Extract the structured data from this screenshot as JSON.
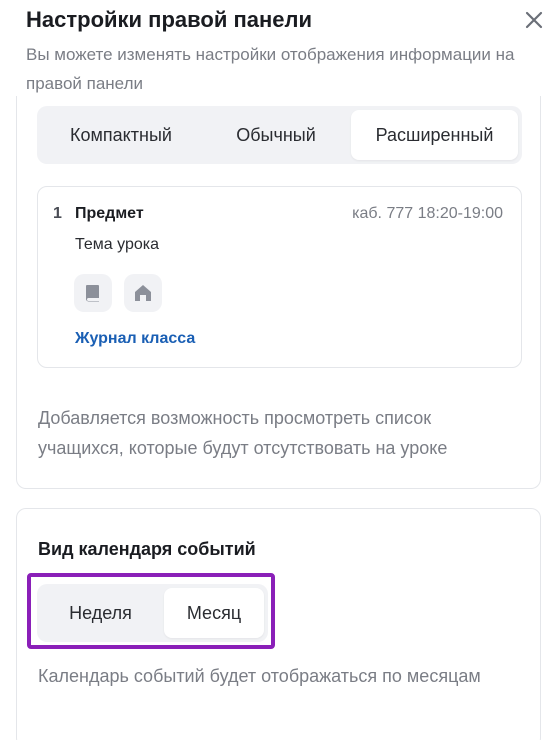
{
  "header": {
    "title": "Настройки правой панели",
    "subtitle": "Вы можете изменять настройки отображения информации на правой панели"
  },
  "view_mode": {
    "options": [
      "Компактный",
      "Обычный",
      "Расширенный"
    ],
    "selected": "Расширенный"
  },
  "lesson_preview": {
    "number": "1",
    "subject": "Предмет",
    "meta": "каб. 777 18:20-19:00",
    "topic": "Тема урока",
    "icons": [
      "book-icon",
      "home-icon"
    ],
    "journal_link": "Журнал класса"
  },
  "view_mode_description": "Добавляется возможность просмотреть список учащихся, которые будут отсутствовать на уроке",
  "calendar": {
    "title": "Вид календаря событий",
    "options": [
      "Неделя",
      "Месяц"
    ],
    "selected": "Месяц",
    "description": "Календарь событий будет отображаться по месяцам"
  },
  "colors": {
    "highlight": "#8a1fb8",
    "link": "#1a5fb4",
    "icon_fill": "#8c909a"
  }
}
